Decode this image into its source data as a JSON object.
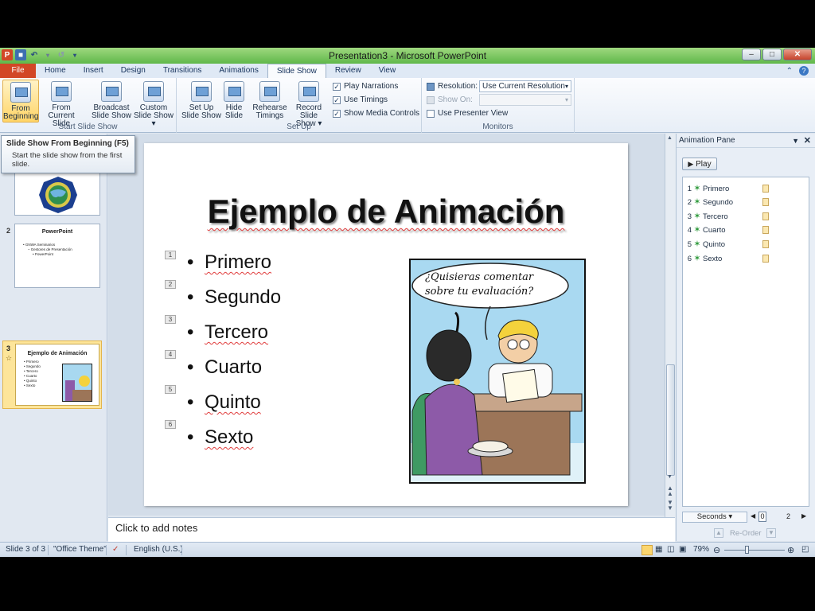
{
  "window": {
    "title": "Presentation3 - Microsoft PowerPoint",
    "min_glyph": "–",
    "max_glyph": "□",
    "close_glyph": "✕"
  },
  "tabs": [
    "File",
    "Home",
    "Insert",
    "Design",
    "Transitions",
    "Animations",
    "Slide Show",
    "Review",
    "View"
  ],
  "active_tab": "Slide Show",
  "ribbon": {
    "start": {
      "from_beginning_1": "From",
      "from_beginning_2": "Beginning",
      "from_current_1": "From",
      "from_current_2": "Current Slide",
      "broadcast_1": "Broadcast",
      "broadcast_2": "Slide Show",
      "custom_1": "Custom",
      "custom_2": "Slide Show ▾",
      "label": "Start Slide Show"
    },
    "setup": {
      "setup_1": "Set Up",
      "setup_2": "Slide Show",
      "hide_1": "Hide",
      "hide_2": "Slide",
      "rehearse_1": "Rehearse",
      "rehearse_2": "Timings",
      "record_1": "Record Slide",
      "record_2": "Show ▾",
      "play_narrations": "Play Narrations",
      "use_timings": "Use Timings",
      "show_media_controls": "Show Media Controls",
      "label": "Set Up"
    },
    "monitors": {
      "resolution_label": "Resolution:",
      "resolution_value": "Use Current Resolution",
      "show_on_label": "Show On:",
      "use_presenter_view": "Use Presenter View",
      "label": "Monitors"
    }
  },
  "tooltip": {
    "title": "Slide Show From Beginning (F5)",
    "body": "Start the slide show from the first slide."
  },
  "thumbnails": [
    {
      "num": "",
      "title": ""
    },
    {
      "num": "2",
      "title": "PowerPoint",
      "lines": [
        "• GNWA Seminarios",
        "– Gestores de Presentación",
        "• PowerPoint"
      ]
    },
    {
      "num": "3",
      "title": "Ejemplo de Animación",
      "lines": [
        "• Primero",
        "• Segundo",
        "• Tercero",
        "• Cuarto",
        "• Quinto",
        "• Sexto"
      ]
    }
  ],
  "slide": {
    "title": "Ejemplo de Animación",
    "bullets": [
      "Primero",
      "Segundo",
      "Tercero",
      "Cuarto",
      "Quinto",
      "Sexto"
    ],
    "anim_tags": [
      "1",
      "2",
      "3",
      "4",
      "5",
      "6"
    ],
    "cartoon_caption_1": "¿Quisieras comentar",
    "cartoon_caption_2": "sobre tu evaluación?"
  },
  "notes_placeholder": "Click to add notes",
  "animation_pane": {
    "title": "Animation Pane",
    "play_label": "Play",
    "items": [
      {
        "num": "1",
        "name": "Primero"
      },
      {
        "num": "2",
        "name": "Segundo"
      },
      {
        "num": "3",
        "name": "Tercero"
      },
      {
        "num": "4",
        "name": "Cuarto"
      },
      {
        "num": "5",
        "name": "Quinto"
      },
      {
        "num": "6",
        "name": "Sexto"
      }
    ],
    "seconds_label": "Seconds ▾",
    "timeline_start": "0",
    "timeline_end": "2",
    "reorder_label": "Re-Order"
  },
  "status": {
    "slide": "Slide 3 of 3",
    "theme": "\"Office Theme\"",
    "language": "English (U.S.)",
    "zoom": "79%"
  },
  "colors": {
    "file_tab": "#d24726",
    "titlebar": "#5fb84a",
    "selected_thumb": "#fde59a"
  }
}
